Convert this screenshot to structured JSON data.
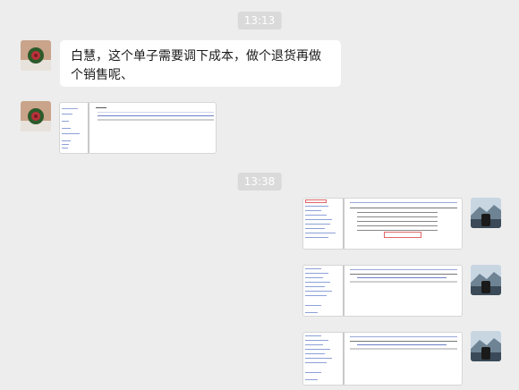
{
  "chat": {
    "time_1": "13:13",
    "message_1": "白慧，这个单子需要调下成本，做个退货再做个销售呢、",
    "time_2": "13:38"
  },
  "icons": {
    "left_avatar": "cactus-flower-avatar",
    "right_avatar": "mountain-lake-avatar"
  }
}
